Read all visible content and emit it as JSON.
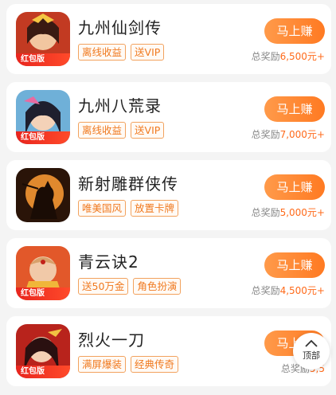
{
  "games": [
    {
      "title": "九州仙剑传",
      "tags": [
        "离线收益",
        "送VIP"
      ],
      "button": "马上赚",
      "reward_prefix": "总奖励",
      "reward_amount": "6,500元+",
      "badge": "红包版"
    },
    {
      "title": "九州八荒录",
      "tags": [
        "离线收益",
        "送VIP"
      ],
      "button": "马上赚",
      "reward_prefix": "总奖励",
      "reward_amount": "7,000元+",
      "badge": "红包版"
    },
    {
      "title": "新射雕群侠传",
      "tags": [
        "唯美国风",
        "放置卡牌"
      ],
      "button": "马上赚",
      "reward_prefix": "总奖励",
      "reward_amount": "5,000元+",
      "badge": ""
    },
    {
      "title": "青云诀2",
      "tags": [
        "送50万金",
        "角色扮演"
      ],
      "button": "马上赚",
      "reward_prefix": "总奖励",
      "reward_amount": "4,500元+",
      "badge": "红包版"
    },
    {
      "title": "烈火一刀",
      "tags": [
        "满屏爆装",
        "经典传奇"
      ],
      "button": "马上赚",
      "reward_prefix": "总奖励",
      "reward_amount": "5,5",
      "badge": "红包版"
    }
  ],
  "back_to_top": {
    "label": "顶部",
    "icon": "chevron-up-icon"
  },
  "colors": {
    "accent": "#ff7a22",
    "tag": "#f07a20",
    "reward": "#ff6a1a"
  }
}
